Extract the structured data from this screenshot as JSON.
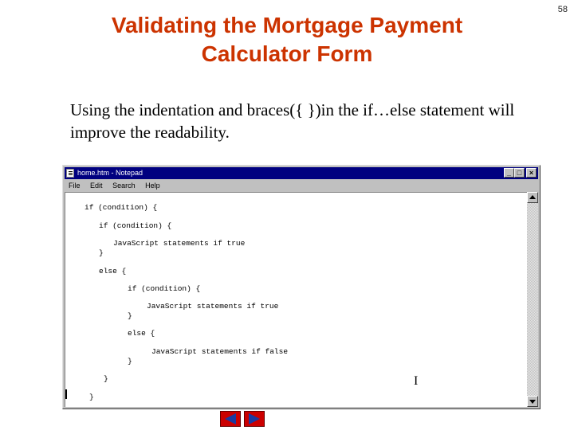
{
  "slide": {
    "title": "Validating the Mortgage Payment Calculator Form",
    "number": "58",
    "body": "Using the indentation and braces({ })in the if…else statement will improve the readability."
  },
  "window": {
    "title": "home.htm - Notepad",
    "minimize": "_",
    "maximize": "□",
    "close": "×",
    "menu": [
      "File",
      "Edit",
      "Search",
      "Help"
    ]
  },
  "code_lines": [
    "if (condition) {",
    "if (condition) {",
    "JavaScript statements if true",
    "}",
    "else {",
    "if (condition) {",
    "JavaScript statements if true",
    "}",
    "else {",
    "JavaScript statements if false",
    "}",
    "}",
    "}"
  ],
  "icons": {
    "scroll_up": "up-arrow-icon",
    "scroll_down": "down-arrow-icon",
    "prev": "previous-slide-icon",
    "next": "next-slide-icon"
  },
  "colors": {
    "title": "#cc3300",
    "titlebar": "#000080",
    "nav": "#cc0000"
  }
}
